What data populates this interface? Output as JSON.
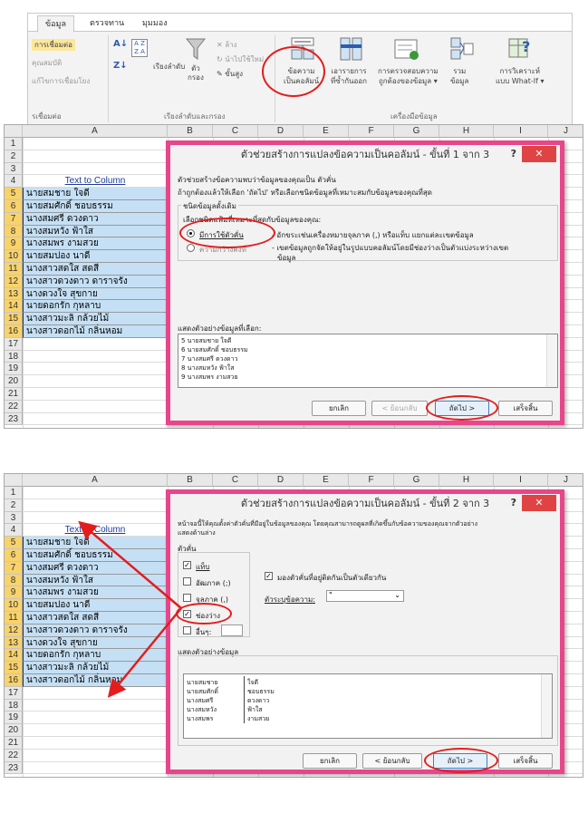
{
  "ribbon": {
    "tabs": [
      "ข้อมูล",
      "ตรวจทาน",
      "มุมมอง"
    ],
    "connections": [
      "การเชื่อมต่อ",
      "คุณสมบัติ",
      "แก้ไขการเชื่อมโยง"
    ],
    "connections_group": "รเชื่อมต่อ",
    "sort_label": "เรียงลำดับ",
    "filter_label": "ตัว\nกรอง",
    "filter_small": [
      "ล้าง",
      "นำไปใช้ใหม่",
      "ขั้นสูง"
    ],
    "sortfilter_group": "เรียงลำดับและกรอง",
    "text_to_columns": "ข้อความ\nเป็นคอลัมน์",
    "remove_dup": "เอารายการ\nที่ซ้ำกันออก",
    "validation": "การตรวจสอบความ\nถูกต้องของข้อมูล ▾",
    "consolidate": "รวม\nข้อมูล",
    "whatif": "การวิเคราะห์\nแบบ What-If ▾",
    "tools_group": "เครื่องมือข้อมูล"
  },
  "sheet": {
    "columns": [
      "A",
      "B",
      "C",
      "D",
      "E",
      "F",
      "G",
      "H",
      "I",
      "J"
    ],
    "rows": [
      "1",
      "2",
      "3",
      "4",
      "5",
      "6",
      "7",
      "8",
      "9",
      "10",
      "11",
      "12",
      "13",
      "14",
      "15",
      "16",
      "17",
      "18",
      "19",
      "20",
      "21",
      "22",
      "23"
    ],
    "header_cell": "Text to Column",
    "names1": [
      "นายสมชาย  ใจดี",
      "นายสมศักดิ์  ชอบธรรม",
      "นางสมศรี ดวงดาว",
      "นางสมหวัง  ฟ้าใส",
      "นางสมพร  งามสวย",
      "นายสมปอง  นาดี",
      "นางสาวสดใส สดสี",
      "นางสาวดวงดาว  ดาราจรัง",
      "นางดวงใจ สุขกาย",
      "นายดอกรัก กุหลาบ",
      "นางสาวมะลิ   กล้วยไม้",
      "นางสาวดอกไม้  กลิ่นหอม"
    ],
    "names2": [
      "นายสมชาย  ใจดี",
      "นายสมศักดิ์  ชอบธรรม",
      "นางสมศรี ดวงดาว",
      "นางสมหวัง  ฟ้าใส",
      "นางสมพร  งามสวย",
      "นายสมปอง  นาดี",
      "นางสาวสดใส สดสี",
      "นางสาวดวงดาว  ดาราจรัง",
      "นางดวงใจ สุขกาย",
      "นายดอกรัก กุหลาบ",
      "นางสาวมะลิ   กล้วยไม้",
      "นางสาวดอกไม้  กลิ่นหอม"
    ]
  },
  "dialog1": {
    "title": "ตัวช่วยสร้างการแปลงข้อความเป็นคอลัมน์ - ขั้นที่ 1 จาก 3",
    "help": "?",
    "close": "✕",
    "line1": "ตัวช่วยสร้างข้อความพบว่าข้อมูลของคุณเป็น ตัวคั่น",
    "line2": "ถ้าถูกต้องแล้วให้เลือก 'ถัดไป' หรือเลือกชนิดข้อมูลที่เหมาะสมกับข้อมูลของคุณที่สุด",
    "section": "ชนิดข้อมูลดั้งเดิม",
    "choose": "เลือกชนิดแฟ้มที่เหมาะที่สุดกับข้อมูลของคุณ:",
    "opt1": "มีการใช้ตัวคั่น",
    "opt1_desc": "- อักขระเช่นเครื่องหมายจุลภาค (,) หรือแท็บ แยกแต่ละเขตข้อมูล",
    "opt2": "ความกว้างคงที่",
    "opt2_desc": "- เขตข้อมูลถูกจัดให้อยู่ในรูปแบบคอลัมน์โดยมีช่องว่างเป็นตัวแบ่งระหว่างเขต",
    "opt2_desc2": "ข้อมูล",
    "preview_label": "แสดงตัวอย่างข้อมูลที่เลือก:",
    "preview": [
      "5 นายสมชาย  ใจดี",
      "6 นายสมศักดิ์  ชอบธรรม",
      "7 นางสมศรี ดวงดาว",
      "8 นางสมหวัง  ฟ้าใส",
      "9 นางสมพร  งามสวย"
    ],
    "cancel": "ยกเลิก",
    "back": "< ย้อนกลับ",
    "next": "ถัดไป >",
    "finish": "เสร็จสิ้น"
  },
  "dialog2": {
    "title": "ตัวช่วยสร้างการแปลงข้อความเป็นคอลัมน์ - ขั้นที่ 2 จาก 3",
    "help": "?",
    "close": "✕",
    "line1": "หน้าจอนี้ให้คุณตั้งค่าตัวคั่นที่มีอยู่ในข้อมูลของคุณ โดยคุณสามารถดูผลที่เกิดขึ้นกับข้อความของคุณจากตัวอย่าง",
    "line2": "แสดงด้านล่าง",
    "delims_label": "ตัวคั่น",
    "tab": "แท็บ",
    "semicolon": "อัฒภาค (;)",
    "comma": "จุลภาค (,)",
    "space": "ช่องว่าง",
    "other": "อื่นๆ:",
    "consecutive": "มองตัวคั่นที่อยู่ติดกันเป็นตัวเดียวกัน",
    "qualifier_label": "ตัวระบุข้อความ:",
    "qualifier_value": "\"",
    "preview_label": "แสดงตัวอย่างข้อมูล",
    "preview_c1": [
      "นายสมชาย",
      "นายสมศักดิ์",
      "นางสมศรี",
      "นางสมหวัง",
      "นางสมพร"
    ],
    "preview_c2": [
      "ใจดี",
      "ชอบธรรม",
      "ดวงดาว",
      "ฟ้าใส",
      "งามสวย"
    ],
    "cancel": "ยกเลิก",
    "back": "< ย้อนกลับ",
    "next": "ถัดไป >",
    "finish": "เสร็จสิ้น"
  },
  "colors": {
    "accent_red": "#e41c1c",
    "dialog_border": "#e8458a",
    "selected_fill": "#c5e0f5",
    "row_selected": "#f8d26b"
  }
}
